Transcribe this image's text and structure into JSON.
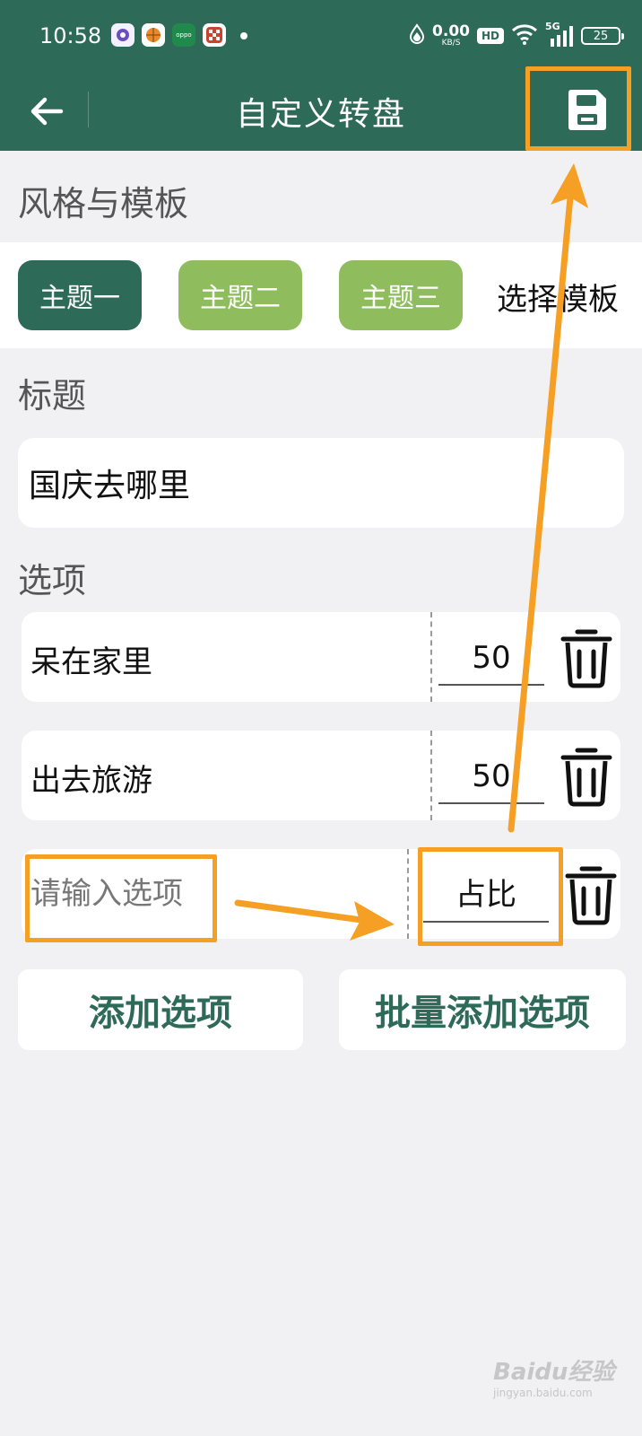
{
  "status_bar": {
    "time": "10:58",
    "net_speed_value": "0.00",
    "net_speed_unit": "KB/S",
    "hd_badge": "HD",
    "signal_label": "5G",
    "battery_level": "25"
  },
  "app_bar": {
    "title": "自定义转盘"
  },
  "style_section": {
    "label": "风格与模板",
    "themes": [
      {
        "label": "主题一",
        "active": true
      },
      {
        "label": "主题二",
        "active": false
      },
      {
        "label": "主题三",
        "active": false
      }
    ],
    "template_link": "选择模板"
  },
  "title_section": {
    "label": "标题",
    "value": "国庆去哪里"
  },
  "options_section": {
    "label": "选项",
    "items": [
      {
        "name": "呆在家里",
        "weight": "50"
      },
      {
        "name": "出去旅游",
        "weight": "50"
      }
    ],
    "new_item": {
      "name_placeholder": "请输入选项",
      "weight_placeholder": "占比"
    }
  },
  "actions": {
    "add_option": "添加选项",
    "batch_add_option": "批量添加选项"
  },
  "watermark": {
    "main": "Baidu经验",
    "sub": "jingyan.baidu.com"
  },
  "colors": {
    "primary": "#2e6a58",
    "theme_inactive": "#8fbd5e",
    "annotation": "#f5a024",
    "background": "#f1f1f4"
  }
}
